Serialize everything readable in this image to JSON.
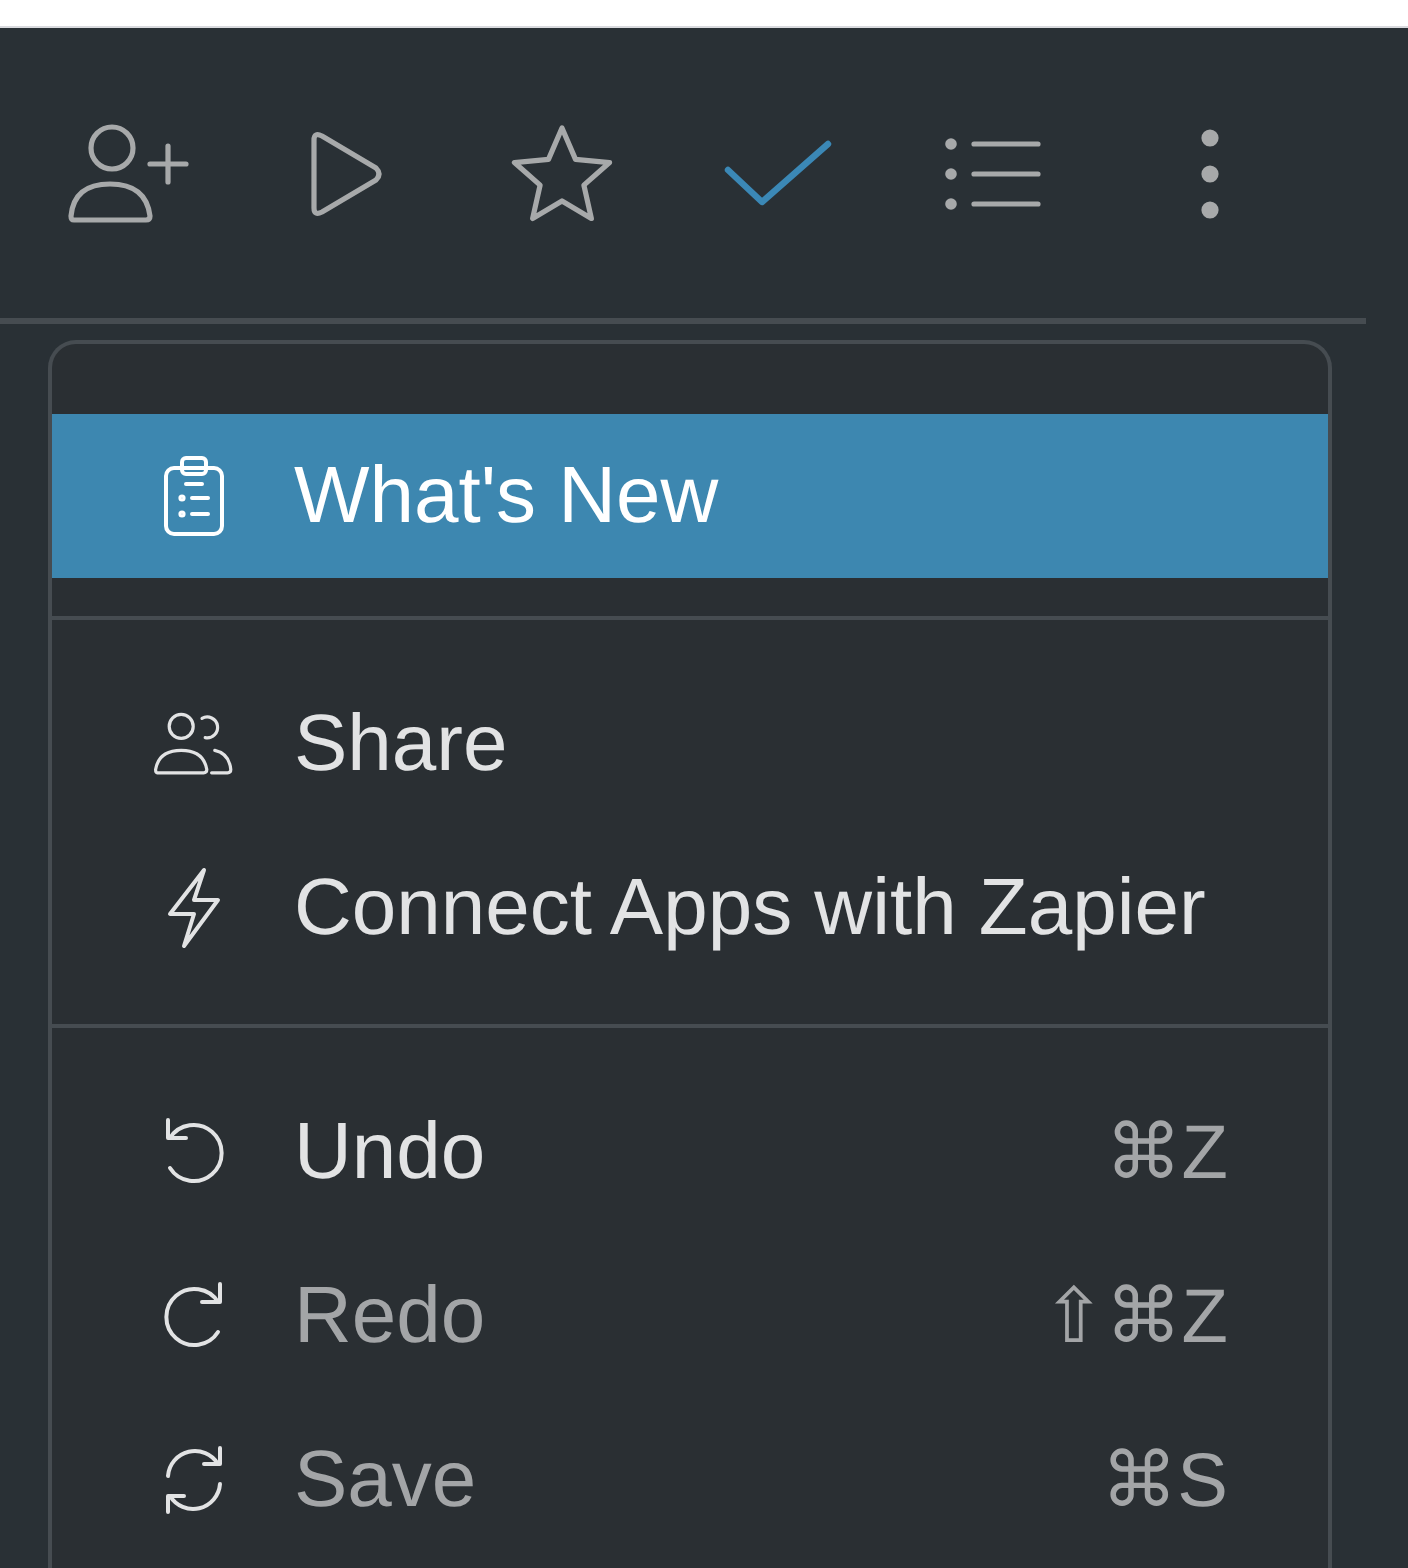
{
  "toolbar": {
    "buttons": [
      {
        "on": false
      },
      {
        "on": false
      },
      {
        "on": false
      },
      {
        "on": true
      },
      {
        "on": false
      },
      {
        "on": false
      }
    ]
  },
  "menu": {
    "sections": [
      {
        "items": [
          {
            "label": "What's New",
            "selected": true,
            "disabled": false
          }
        ]
      },
      {
        "items": [
          {
            "label": "Share",
            "selected": false,
            "disabled": false
          },
          {
            "label": "Connect Apps with Zapier",
            "selected": false,
            "disabled": false
          }
        ]
      },
      {
        "items": [
          {
            "label": "Undo",
            "shortcut": "⌘Z",
            "selected": false,
            "disabled": false
          },
          {
            "label": "Redo",
            "shortcut": "⇧⌘Z",
            "selected": false,
            "disabled": true
          },
          {
            "label": "Save",
            "shortcut": "⌘S",
            "selected": false,
            "disabled": true
          }
        ]
      }
    ]
  }
}
